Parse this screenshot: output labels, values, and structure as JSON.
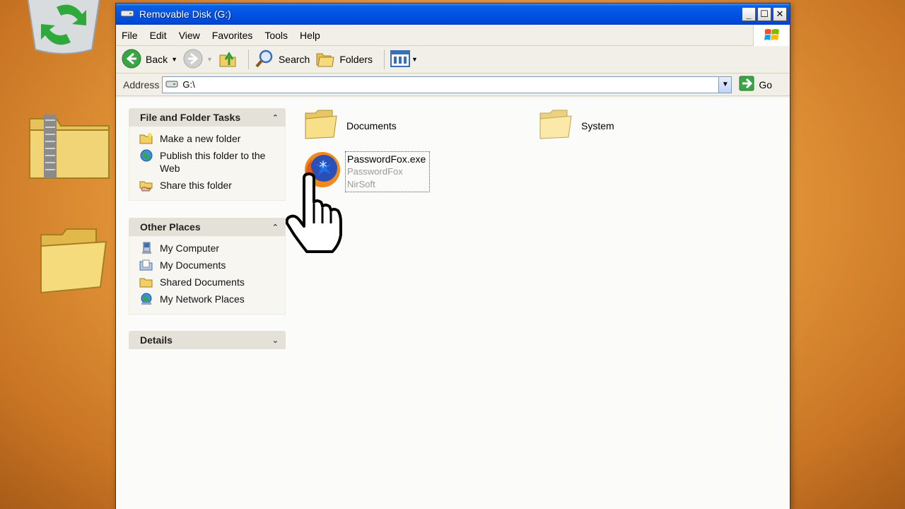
{
  "window": {
    "title": "Removable Disk (G:)",
    "controls": [
      "minimize",
      "maximize",
      "close"
    ]
  },
  "menubar": {
    "items": [
      "File",
      "Edit",
      "View",
      "Favorites",
      "Tools",
      "Help"
    ]
  },
  "toolbar": {
    "back_label": "Back",
    "search_label": "Search",
    "folders_label": "Folders"
  },
  "address": {
    "label": "Address",
    "value": "G:\\",
    "go_label": "Go"
  },
  "task_pane": {
    "file_folder_tasks": {
      "title": "File and Folder Tasks",
      "items": [
        {
          "label": "Make a new folder",
          "icon": "new-folder-icon"
        },
        {
          "label": "Publish this folder to the Web",
          "icon": "publish-web-icon"
        },
        {
          "label": "Share this folder",
          "icon": "share-folder-icon"
        }
      ]
    },
    "other_places": {
      "title": "Other Places",
      "items": [
        {
          "label": "My Computer",
          "icon": "my-computer-icon"
        },
        {
          "label": "My Documents",
          "icon": "my-documents-icon"
        },
        {
          "label": "Shared Documents",
          "icon": "shared-documents-icon"
        },
        {
          "label": "My Network Places",
          "icon": "network-places-icon"
        }
      ]
    },
    "details": {
      "title": "Details"
    }
  },
  "files": [
    {
      "name": "Documents",
      "type": "folder"
    },
    {
      "name": "System",
      "type": "folder"
    },
    {
      "name": "PasswordFox.exe",
      "type": "application",
      "description": "PasswordFox",
      "company": "NirSoft"
    }
  ],
  "colors": {
    "titlebar_blue": "#0054e3",
    "desktop_orange": "#e79a3c",
    "folder_yellow": "#f5d66e"
  }
}
